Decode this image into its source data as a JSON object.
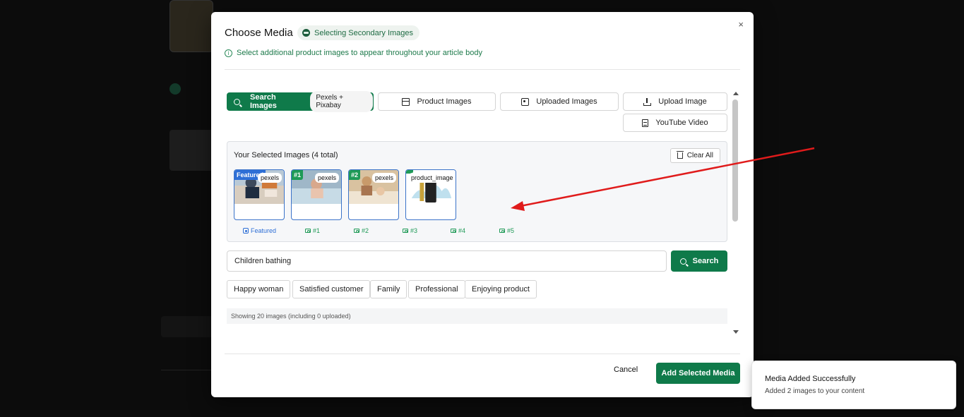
{
  "modal": {
    "title": "Choose Media",
    "mode_pill": "Selecting Secondary Images",
    "subtitle": "Select additional product images to appear throughout your article body",
    "close": "×"
  },
  "tabs": [
    {
      "label": "Search Images",
      "badge": "Pexels + Pixabay",
      "icon": "search-icon",
      "active": true
    },
    {
      "label": "Product Images",
      "icon": "box-icon",
      "active": false
    },
    {
      "label": "Uploaded Images",
      "icon": "image-icon",
      "active": false
    },
    {
      "label": "Upload Image",
      "icon": "upload-icon",
      "active": false
    },
    {
      "label": "YouTube Video",
      "icon": "file-icon",
      "active": false
    }
  ],
  "selected": {
    "title": "Your Selected Images (4 total)",
    "clear_label": "Clear All",
    "thumbs": [
      {
        "badge": "Featured",
        "source": "pexels",
        "badge_color": "#2e6fd6"
      },
      {
        "badge": "#1",
        "source": "pexels",
        "badge_color": "#1f9a57"
      },
      {
        "badge": "#2",
        "source": "pexels",
        "badge_color": "#1f9a57"
      },
      {
        "badge": "",
        "source": "product_image",
        "badge_color": "#1f9a57"
      }
    ],
    "slots": [
      "Featured",
      "#1",
      "#2",
      "#3",
      "#4",
      "#5"
    ]
  },
  "search": {
    "value": "Children bathing",
    "button": "Search"
  },
  "suggestions": [
    "Happy woman",
    "Satisfied customer",
    "Family",
    "Professional",
    "Enjoying product"
  ],
  "status": "Showing 20 images (including 0 uploaded)",
  "footer": {
    "cancel": "Cancel",
    "confirm": "Add Selected Media"
  },
  "toast": {
    "title": "Media Added Successfully",
    "body": "Added 2 images to your content"
  },
  "colors": {
    "accent": "#0f7a4a",
    "featured": "#2e6fd6",
    "annotation_arrow": "#e01b1b"
  }
}
